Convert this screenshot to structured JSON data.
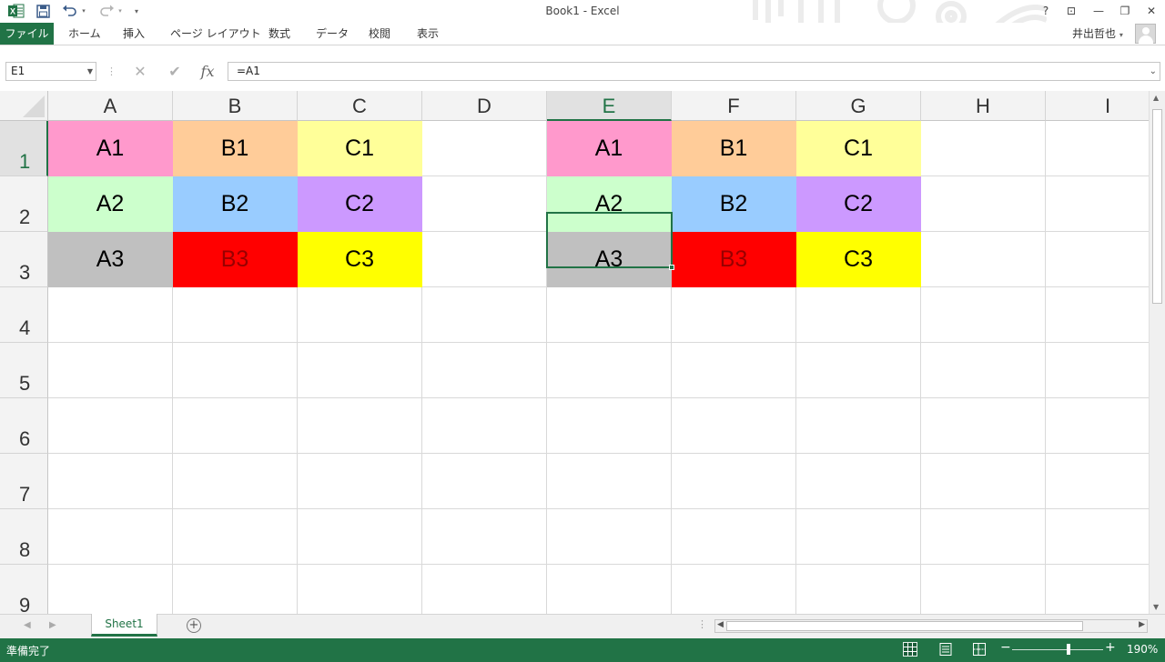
{
  "window": {
    "title": "Book1 - Excel",
    "help": "?",
    "restore_ribbon": "⊡",
    "minimize": "—",
    "restore": "❐",
    "close": "✕"
  },
  "quick_access": {
    "excel_logo": "X",
    "save_icon": "save-icon",
    "undo_icon": "undo-icon",
    "redo_icon": "redo-icon",
    "customize_icon": "customize-icon"
  },
  "ribbon": {
    "file_tab": "ファイル",
    "tabs": [
      "ホーム",
      "挿入",
      "ページ レイアウト",
      "数式",
      "データ",
      "校閲",
      "表示"
    ],
    "user_name": "井出哲也"
  },
  "formula_bar": {
    "name_box": "E1",
    "cancel_glyph": "✕",
    "enter_glyph": "✔",
    "fx_glyph": "fx",
    "formula": "=A1"
  },
  "sheet": {
    "columns": [
      "A",
      "B",
      "C",
      "D",
      "E",
      "F",
      "G",
      "H",
      "I"
    ],
    "rows": [
      "1",
      "2",
      "3",
      "4",
      "5",
      "6",
      "7",
      "8",
      "9"
    ],
    "selected_column": "E",
    "selected_row": "1",
    "cells": [
      {
        "ref": "A1",
        "value": "A1",
        "fill": "#FF99CC",
        "color": "#000000"
      },
      {
        "ref": "B1",
        "value": "B1",
        "fill": "#FFCC99",
        "color": "#000000"
      },
      {
        "ref": "C1",
        "value": "C1",
        "fill": "#FFFF99",
        "color": "#000000"
      },
      {
        "ref": "A2",
        "value": "A2",
        "fill": "#CCFFCC",
        "color": "#000000"
      },
      {
        "ref": "B2",
        "value": "B2",
        "fill": "#99CCFF",
        "color": "#000000"
      },
      {
        "ref": "C2",
        "value": "C2",
        "fill": "#CC99FF",
        "color": "#000000"
      },
      {
        "ref": "A3",
        "value": "A3",
        "fill": "#C0C0C0",
        "color": "#000000"
      },
      {
        "ref": "B3",
        "value": "B3",
        "fill": "#FF0000",
        "color": "#990000"
      },
      {
        "ref": "C3",
        "value": "C3",
        "fill": "#FFFF00",
        "color": "#000000"
      },
      {
        "ref": "E1",
        "value": "A1",
        "fill": "#FF99CC",
        "color": "#000000"
      },
      {
        "ref": "F1",
        "value": "B1",
        "fill": "#FFCC99",
        "color": "#000000"
      },
      {
        "ref": "G1",
        "value": "C1",
        "fill": "#FFFF99",
        "color": "#000000"
      },
      {
        "ref": "E2",
        "value": "A2",
        "fill": "#CCFFCC",
        "color": "#000000"
      },
      {
        "ref": "F2",
        "value": "B2",
        "fill": "#99CCFF",
        "color": "#000000"
      },
      {
        "ref": "G2",
        "value": "C2",
        "fill": "#CC99FF",
        "color": "#000000"
      },
      {
        "ref": "E3",
        "value": "A3",
        "fill": "#C0C0C0",
        "color": "#000000"
      },
      {
        "ref": "F3",
        "value": "B3",
        "fill": "#FF0000",
        "color": "#990000"
      },
      {
        "ref": "G3",
        "value": "C3",
        "fill": "#FFFF00",
        "color": "#000000"
      }
    ]
  },
  "sheet_tabs": {
    "prev": "◀",
    "next": "▶",
    "tabs": [
      "Sheet1"
    ],
    "add": "+"
  },
  "status_bar": {
    "status": "準備完了",
    "zoom_minus": "−",
    "zoom_plus": "+",
    "zoom_fraction": 0.62,
    "zoom_level": "190%"
  },
  "colors": {
    "accent": "#217346"
  }
}
